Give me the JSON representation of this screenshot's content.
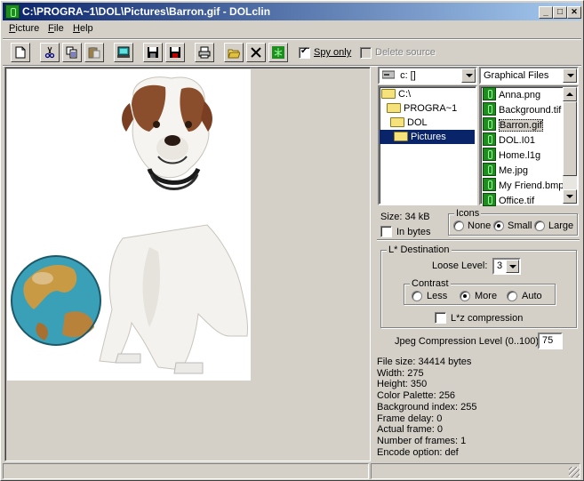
{
  "window": {
    "title": "C:\\PROGRA~1\\DOL\\Pictures\\Barron.gif - DOLclin",
    "minimize": "_",
    "maximize": "□",
    "close": "✕"
  },
  "menu": [
    {
      "label": "Picture"
    },
    {
      "label": "File"
    },
    {
      "label": "Help"
    }
  ],
  "toolbar": {
    "spy_only_label": "Spy only",
    "spy_only_checked": true,
    "delete_source_label": "Delete source",
    "delete_source_checked": false
  },
  "drive": {
    "selected": "c: []"
  },
  "filter": {
    "selected": "Graphical Files"
  },
  "folders": [
    {
      "label": "C:\\"
    },
    {
      "label": "PROGRA~1"
    },
    {
      "label": "DOL"
    },
    {
      "label": "Pictures",
      "selected": true
    }
  ],
  "files": [
    {
      "label": "Anna.png"
    },
    {
      "label": "Background.tif"
    },
    {
      "label": "Barron.gif",
      "selected": true
    },
    {
      "label": "DOL.I01"
    },
    {
      "label": "Home.l1g"
    },
    {
      "label": "Me.jpg"
    },
    {
      "label": "My Friend.bmp"
    },
    {
      "label": "Office.tif"
    }
  ],
  "size": {
    "text": "Size: 34 kB",
    "in_bytes_label": "In bytes",
    "in_bytes_checked": false
  },
  "icons": {
    "title": "Icons",
    "options": [
      "None",
      "Small",
      "Large"
    ],
    "selected": "Small"
  },
  "destination": {
    "title": "L* Destination",
    "loose_level_label": "Loose Level:",
    "loose_level_value": "3",
    "contrast_title": "Contrast",
    "contrast_options": [
      "Less",
      "More",
      "Auto"
    ],
    "contrast_selected": "More",
    "lzw_label": "L*z compression",
    "lzw_checked": false
  },
  "jpeg": {
    "label": "Jpeg Compression Level (0..100):",
    "value": "75"
  },
  "file_info": [
    "File size: 34414 bytes",
    "Width: 275",
    "Height: 350",
    "Color Palette: 256",
    "Background index: 255",
    "Frame delay: 0",
    "Actual frame: 0",
    "Number of frames: 1",
    "Encode option: def"
  ]
}
